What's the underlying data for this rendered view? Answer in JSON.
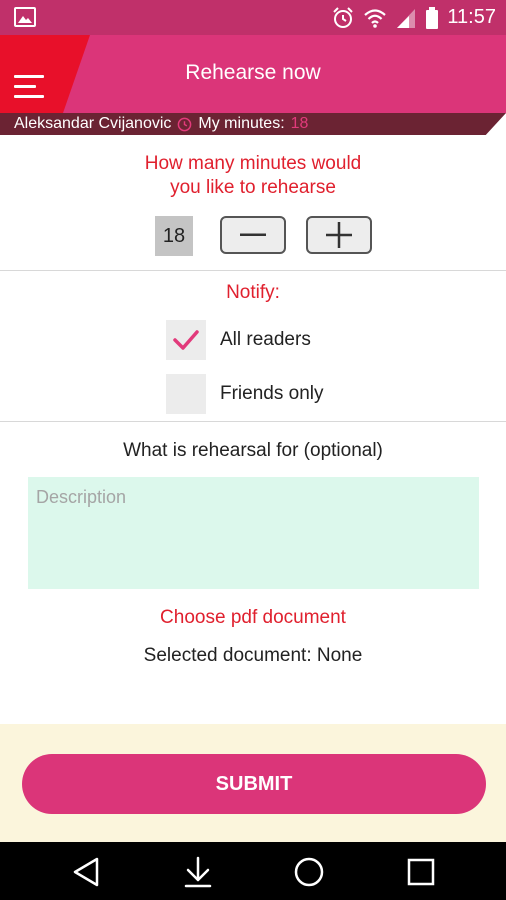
{
  "status_bar": {
    "time": "11:57",
    "icons": [
      "gallery-icon",
      "alarm-icon",
      "wifi-icon",
      "signal-icon",
      "battery-icon"
    ]
  },
  "header": {
    "title": "Rehearse now",
    "menu_icon": "hamburger-menu-icon"
  },
  "user": {
    "name": "Aleksandar Cvijanovic",
    "minutes_label": "My minutes:",
    "minutes_value": "18"
  },
  "minutes": {
    "question_line1": "How many minutes would",
    "question_line2": "you like to rehearse",
    "value": "18"
  },
  "notify": {
    "label": "Notify:",
    "options": [
      {
        "label": "All readers",
        "checked": true
      },
      {
        "label": "Friends only",
        "checked": false
      }
    ]
  },
  "rehearsal": {
    "label": "What is rehearsal for (optional)",
    "description_placeholder": "Description",
    "description_value": ""
  },
  "document": {
    "choose_label": "Choose pdf document",
    "selected_label": "Selected document: None"
  },
  "submit": {
    "label": "SUBMIT"
  },
  "colors": {
    "primary": "#db3579",
    "accent_red": "#e0202e",
    "status_bar": "#c0306a",
    "strip": "#6b2333",
    "footer": "#fbf5dc",
    "description_bg": "#dcf8ec"
  },
  "nav": {
    "icons": [
      "back-icon",
      "download-icon",
      "home-icon",
      "recents-icon"
    ]
  }
}
